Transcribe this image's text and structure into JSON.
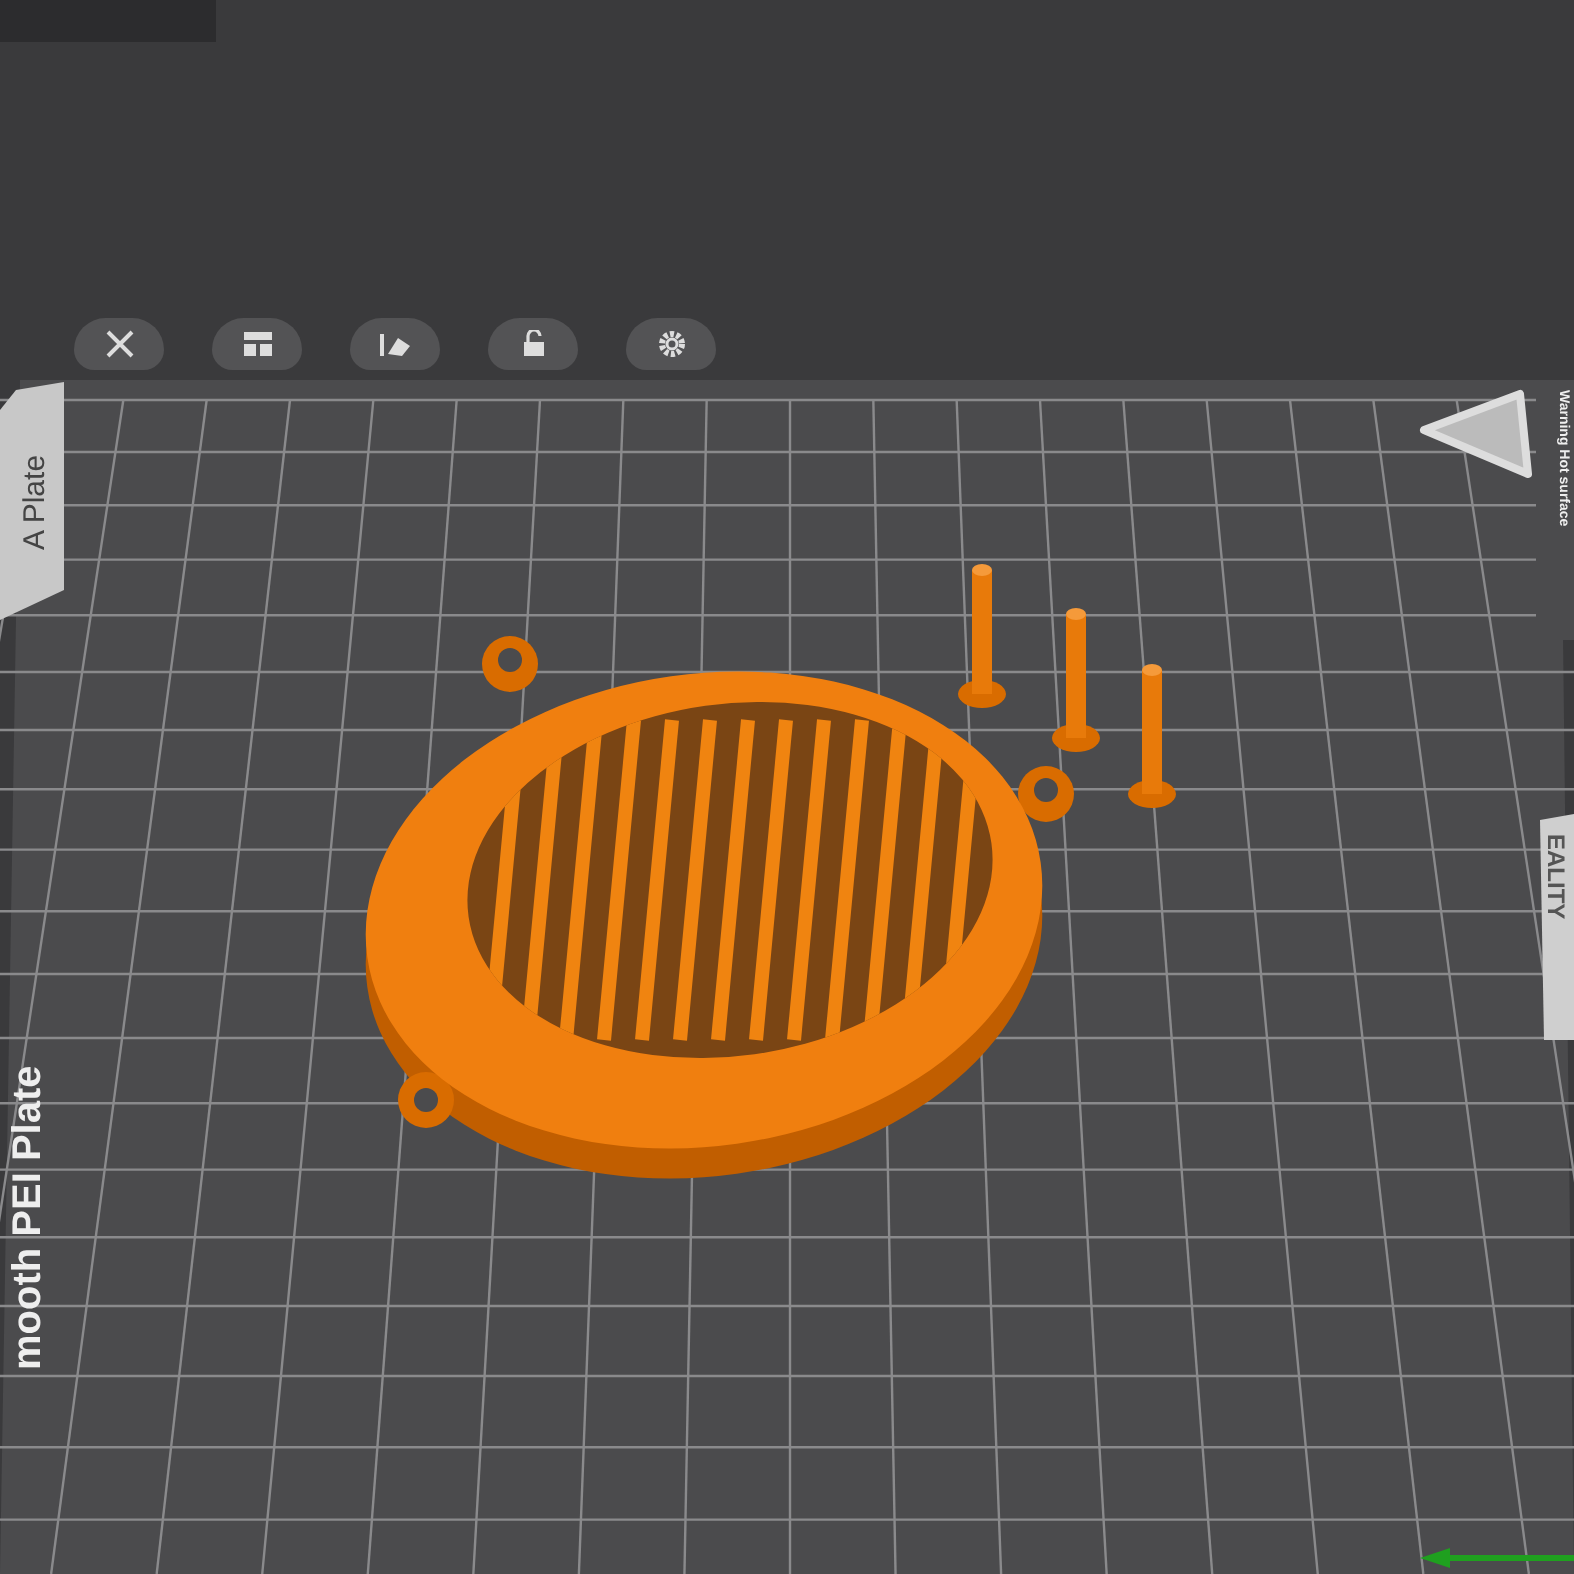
{
  "plate_tab": {
    "label": "A Plate"
  },
  "bed": {
    "plate_name": "mooth PEI Plate",
    "brand": "EALITY",
    "warning": "Warning Hot surface"
  }
}
